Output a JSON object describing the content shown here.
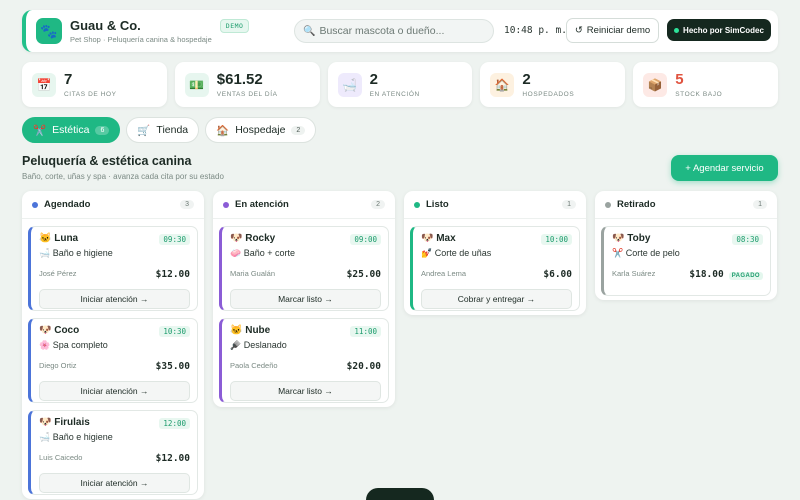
{
  "header": {
    "title": "Guau & Co.",
    "subtitle": "Pet Shop · Peluquería canina & hospedaje",
    "badge": "DEMO",
    "search_placeholder": "Buscar mascota o dueño...",
    "clock": "10:48 p. m.",
    "reset_label": "Reiniciar demo",
    "made_by_label": "Hecho por SimCodec"
  },
  "stats": [
    {
      "icon": "calendar-icon",
      "glyph": "📅",
      "value": "7",
      "label": "CITAS DE HOY",
      "bg": "#e7f6ef"
    },
    {
      "icon": "money-icon",
      "glyph": "💵",
      "value": "$61.52",
      "label": "VENTAS DEL DÍA",
      "bg": "#e7f6ef"
    },
    {
      "icon": "bath-icon",
      "glyph": "🛁",
      "value": "2",
      "label": "EN ATENCIÓN",
      "bg": "#eeeafc"
    },
    {
      "icon": "house-icon",
      "glyph": "🏠",
      "value": "2",
      "label": "HOSPEDADOS",
      "bg": "#fdf1e0"
    },
    {
      "icon": "box-icon",
      "glyph": "📦",
      "value": "5",
      "label": "STOCK BAJO",
      "bg": "#fde9e5"
    }
  ],
  "tabs": [
    {
      "icon": "scissors-icon",
      "glyph": "✂️",
      "label": "Estética",
      "count": "6",
      "active": true
    },
    {
      "icon": "cart-icon",
      "glyph": "🛒",
      "label": "Tienda",
      "count": "",
      "active": false
    },
    {
      "icon": "house-icon",
      "glyph": "🏠",
      "label": "Hospedaje",
      "count": "2",
      "active": false
    }
  ],
  "section": {
    "title": "Peluquería & estética canina",
    "subtitle": "Baño, corte, uñas y spa · avanza cada cita por su estado",
    "add_label": "+ Agendar servicio"
  },
  "columns": [
    {
      "title": "Agendado",
      "count": "3",
      "color": "#4c74d9",
      "cards": [
        {
          "pet": "🐱 Luna",
          "time": "09:30",
          "service": "🛁 Baño e higiene",
          "owner": "José Pérez",
          "price": "$12.00",
          "action": "Iniciar atención →"
        },
        {
          "pet": "🐶 Coco",
          "time": "10:30",
          "service": "🌸 Spa completo",
          "owner": "Diego Ortiz",
          "price": "$35.00",
          "action": "Iniciar atención →"
        },
        {
          "pet": "🐶 Firulais",
          "time": "12:00",
          "service": "🛁 Baño e higiene",
          "owner": "Luis Caicedo",
          "price": "$12.00",
          "action": "Iniciar atención →"
        }
      ]
    },
    {
      "title": "En atención",
      "count": "2",
      "color": "#8b5cd6",
      "cards": [
        {
          "pet": "🐶 Rocky",
          "time": "09:00",
          "service": "🧼 Baño + corte",
          "owner": "Maria Gualán",
          "price": "$25.00",
          "action": "Marcar listo →"
        },
        {
          "pet": "🐱 Nube",
          "time": "11:00",
          "service": "🪮 Deslanado",
          "owner": "Paola Cedeño",
          "price": "$20.00",
          "action": "Marcar listo →"
        }
      ]
    },
    {
      "title": "Listo",
      "count": "1",
      "color": "#1fb884",
      "cards": [
        {
          "pet": "🐶 Max",
          "time": "10:00",
          "service": "💅 Corte de uñas",
          "owner": "Andrea Lema",
          "price": "$6.00",
          "action": "Cobrar y entregar →"
        }
      ]
    },
    {
      "title": "Retirado",
      "count": "1",
      "color": "#9aa3a0",
      "cards": [
        {
          "pet": "🐶 Toby",
          "time": "08:30",
          "service": "✂️ Corte de pelo",
          "owner": "Karla Suárez",
          "price": "$18.00",
          "paid": "PAGADO",
          "action": ""
        }
      ]
    }
  ]
}
